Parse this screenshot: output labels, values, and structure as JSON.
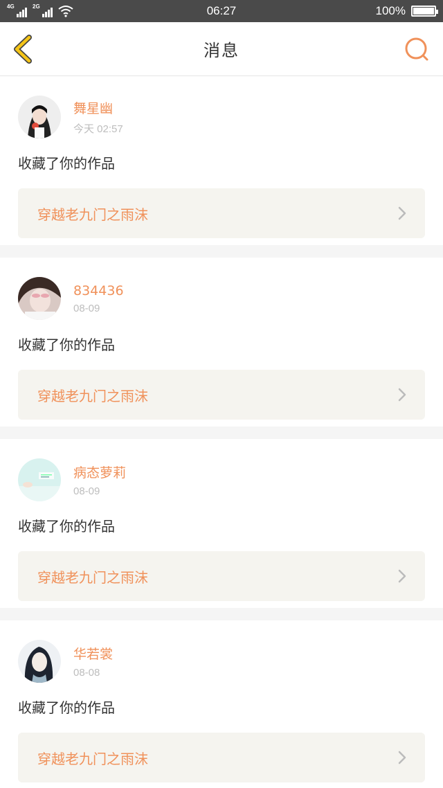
{
  "status_bar": {
    "network1": "4G",
    "network2": "2G",
    "time": "06:27",
    "battery": "100%"
  },
  "header": {
    "title": "消息"
  },
  "colors": {
    "accent": "#f0915a",
    "back_icon": "#f5c518",
    "card_link_bg": "#f5f4ef"
  },
  "messages": [
    {
      "username": "舞星幽",
      "time": "今天 02:57",
      "action": "收藏了你的作品",
      "work_title": "穿越老九门之雨沫"
    },
    {
      "username": "834436",
      "time": "08-09",
      "action": "收藏了你的作品",
      "work_title": "穿越老九门之雨沫"
    },
    {
      "username": "病态萝莉",
      "time": "08-09",
      "action": "收藏了你的作品",
      "work_title": "穿越老九门之雨沫"
    },
    {
      "username": "华若裳",
      "time": "08-08",
      "action": "收藏了你的作品",
      "work_title": "穿越老九门之雨沫"
    }
  ]
}
